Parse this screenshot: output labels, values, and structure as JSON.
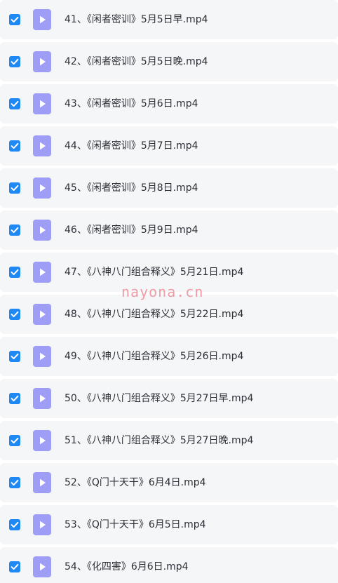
{
  "colors": {
    "checkbox": "#1e88f5",
    "row_background": "#f5f6f8",
    "video_icon": "#9e9ef7",
    "watermark": "#f08a96"
  },
  "files": [
    {
      "name": "41、《闲者密训》5月5日早.mp4",
      "checked": true,
      "icon": "video-file-icon"
    },
    {
      "name": "42、《闲者密训》5月5日晚.mp4",
      "checked": true,
      "icon": "video-file-icon"
    },
    {
      "name": "43、《闲者密训》5月6日.mp4",
      "checked": true,
      "icon": "video-file-icon"
    },
    {
      "name": "44、《闲者密训》5月7日.mp4",
      "checked": true,
      "icon": "video-file-icon"
    },
    {
      "name": "45、《闲者密训》5月8日.mp4",
      "checked": true,
      "icon": "video-file-icon"
    },
    {
      "name": "46、《闲者密训》5月9日.mp4",
      "checked": true,
      "icon": "video-file-icon"
    },
    {
      "name": "47、《八神八门组合释义》5月21日.mp4",
      "checked": true,
      "icon": "video-file-icon"
    },
    {
      "name": "48、《八神八门组合释义》5月22日.mp4",
      "checked": true,
      "icon": "video-file-icon"
    },
    {
      "name": "49、《八神八门组合释义》5月26日.mp4",
      "checked": true,
      "icon": "video-file-icon"
    },
    {
      "name": "50、《八神八门组合释义》5月27日早.mp4",
      "checked": true,
      "icon": "video-file-icon"
    },
    {
      "name": "51、《八神八门组合释义》5月27日晚.mp4",
      "checked": true,
      "icon": "video-file-icon"
    },
    {
      "name": "52、《Q门十天干》6月4日.mp4",
      "checked": true,
      "icon": "video-file-icon"
    },
    {
      "name": "53、《Q门十天干》6月5日.mp4",
      "checked": true,
      "icon": "video-file-icon"
    },
    {
      "name": "54、《化四害》6月6日.mp4",
      "checked": true,
      "icon": "video-file-icon"
    }
  ],
  "watermark": {
    "text": "nayona.cn"
  }
}
